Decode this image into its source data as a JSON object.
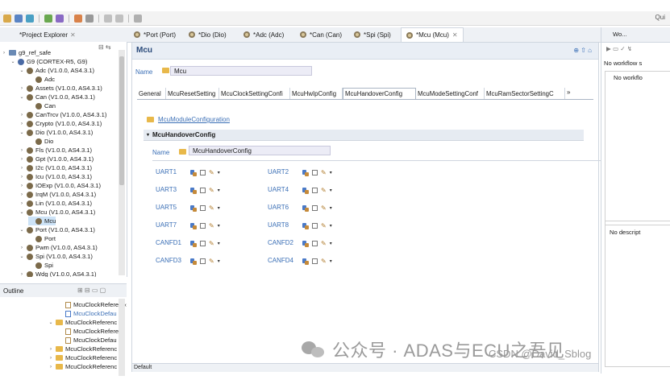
{
  "top_right_label": "Qui",
  "project_explorer": {
    "title": "*Project Explorer",
    "rows": [
      {
        "label": "g9_ref_safe",
        "level": 0,
        "expand": "›",
        "icon": "project"
      },
      {
        "label": "G9 (CORTEX-R5, G9)",
        "level": 1,
        "expand": "⌄",
        "icon": "chip"
      },
      {
        "label": "Adc (V1.0.0, AS4.3.1)",
        "level": 2,
        "expand": "⌄",
        "icon": "module"
      },
      {
        "label": "Adc",
        "level": 3,
        "expand": "",
        "icon": "module"
      },
      {
        "label": "Assets (V1.0.0, AS4.3.1)",
        "level": 2,
        "expand": "›",
        "icon": "module"
      },
      {
        "label": "Can (V1.0.0, AS4.3.1)",
        "level": 2,
        "expand": "⌄",
        "icon": "module"
      },
      {
        "label": "Can",
        "level": 3,
        "expand": "",
        "icon": "module"
      },
      {
        "label": "CanTrcv (V1.0.0, AS4.3.1)",
        "level": 2,
        "expand": "›",
        "icon": "module"
      },
      {
        "label": "Crypto (V1.0.0, AS4.3.1)",
        "level": 2,
        "expand": "›",
        "icon": "module"
      },
      {
        "label": "Dio (V1.0.0, AS4.3.1)",
        "level": 2,
        "expand": "⌄",
        "icon": "module"
      },
      {
        "label": "Dio",
        "level": 3,
        "expand": "",
        "icon": "module"
      },
      {
        "label": "Fls (V1.0.0, AS4.3.1)",
        "level": 2,
        "expand": "›",
        "icon": "module"
      },
      {
        "label": "Gpt (V1.0.0, AS4.3.1)",
        "level": 2,
        "expand": "›",
        "icon": "module"
      },
      {
        "label": "I2c (V1.0.0, AS4.3.1)",
        "level": 2,
        "expand": "›",
        "icon": "module"
      },
      {
        "label": "Icu (V1.0.0, AS4.3.1)",
        "level": 2,
        "expand": "›",
        "icon": "module"
      },
      {
        "label": "IOExp (V1.0.0, AS4.3.1)",
        "level": 2,
        "expand": "›",
        "icon": "module"
      },
      {
        "label": "IrqM (V1.0.0, AS4.3.1)",
        "level": 2,
        "expand": "›",
        "icon": "module"
      },
      {
        "label": "Lin (V1.0.0, AS4.3.1)",
        "level": 2,
        "expand": "›",
        "icon": "module"
      },
      {
        "label": "Mcu (V1.0.0, AS4.3.1)",
        "level": 2,
        "expand": "⌄",
        "icon": "module"
      },
      {
        "label": "Mcu",
        "level": 3,
        "expand": "",
        "icon": "module",
        "selected": true
      },
      {
        "label": "Port (V1.0.0, AS4.3.1)",
        "level": 2,
        "expand": "⌄",
        "icon": "module"
      },
      {
        "label": "Port",
        "level": 3,
        "expand": "",
        "icon": "module"
      },
      {
        "label": "Pwm (V1.0.0, AS4.3.1)",
        "level": 2,
        "expand": "›",
        "icon": "module"
      },
      {
        "label": "Spi (V1.0.0, AS4.3.1)",
        "level": 2,
        "expand": "⌄",
        "icon": "module"
      },
      {
        "label": "Spi",
        "level": 3,
        "expand": "",
        "icon": "module"
      },
      {
        "label": "Wdg (V1.0.0, AS4.3.1)",
        "level": 2,
        "expand": "›",
        "icon": "module"
      }
    ]
  },
  "outline": {
    "title": "Outline",
    "rows": [
      {
        "label": "McuClockReferen",
        "level": 2,
        "expand": "",
        "icon": "doc",
        "trail": "‹"
      },
      {
        "label": "McuClockDefau",
        "level": 2,
        "expand": "",
        "icon": "doc-blue",
        "link": true
      },
      {
        "label": "McuClockReferenc",
        "level": 1,
        "expand": "⌄",
        "icon": "folder"
      },
      {
        "label": "McuClockReferenc",
        "level": 2,
        "expand": "",
        "icon": "doc"
      },
      {
        "label": "McuClockDefau",
        "level": 2,
        "expand": "",
        "icon": "doc"
      },
      {
        "label": "McuClockReferenc",
        "level": 1,
        "expand": "›",
        "icon": "folder"
      },
      {
        "label": "McuClockReferenc",
        "level": 1,
        "expand": "›",
        "icon": "folder"
      },
      {
        "label": "McuClockReferenc",
        "level": 1,
        "expand": "›",
        "icon": "folder"
      }
    ]
  },
  "editor_tabs": [
    {
      "label": "*Port (Port)"
    },
    {
      "label": "*Dio (Dio)"
    },
    {
      "label": "*Adc (Adc)"
    },
    {
      "label": "*Can (Can)"
    },
    {
      "label": "*Spi (Spi)"
    },
    {
      "label": "*Mcu (Mcu)",
      "active": true
    }
  ],
  "editor": {
    "title": "Mcu",
    "name_label": "Name",
    "name_value": "Mcu",
    "config_tabs": [
      {
        "label": "General"
      },
      {
        "label": "McuResetSetting"
      },
      {
        "label": "McuClockSettingConfi"
      },
      {
        "label": "McuHwIpConfig"
      },
      {
        "label": "McuHandoverConfig",
        "active": true
      },
      {
        "label": "McuModeSettingConf"
      },
      {
        "label": "McuRamSectorSettingC"
      }
    ],
    "tab_overflow": "»",
    "module_config_link": "McuModuleConfiguration",
    "section_title": "McuHandoverConfig",
    "inner_name_label": "Name",
    "inner_name_value": "McuHandoverConfig",
    "refs_left": [
      "UART1",
      "UART3",
      "UART5",
      "UART7",
      "CANFD1",
      "CANFD3"
    ],
    "refs_right": [
      "UART2",
      "UART4",
      "UART6",
      "UART8",
      "CANFD2",
      "CANFD4"
    ],
    "bottom_label": "Default"
  },
  "right_panel": {
    "title": "Wo...",
    "workflow_label": "No workflow s",
    "workflow_item": "No workflo",
    "description": "No descript"
  },
  "watermark": {
    "text": "公众号 · ADAS与ECU之吾见",
    "credit": "CSDN @David_Sblog"
  },
  "colors": {
    "accent": "#3b6fb6",
    "selection": "#cde3f7",
    "header_bg": "#e9eef5"
  }
}
